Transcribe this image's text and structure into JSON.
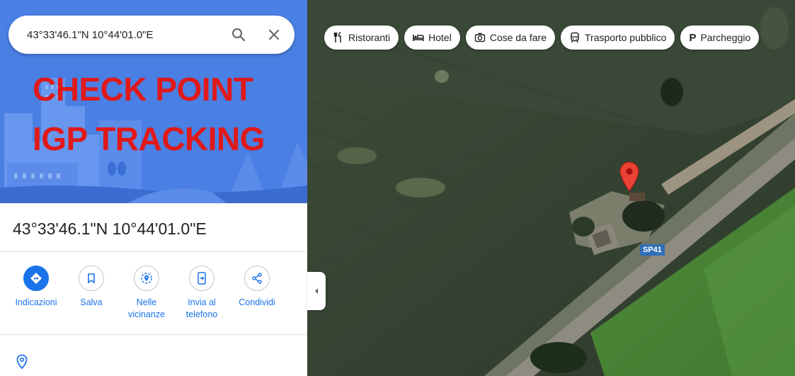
{
  "search": {
    "value": "43°33'46.1\"N 10°44'01.0\"E",
    "search_icon": "search-icon",
    "close_icon": "close-icon"
  },
  "hero": {
    "overlay_line1": "CHECK POINT",
    "overlay_line2": "IGP TRACKING",
    "overlay_color": "#e01919"
  },
  "place": {
    "title": "43°33'46.1\"N 10°44'01.0\"E"
  },
  "actions": [
    {
      "label": "Indicazioni",
      "icon": "directions-icon"
    },
    {
      "label": "Salva",
      "icon": "bookmark-icon"
    },
    {
      "label": "Nelle vicinanze",
      "icon": "nearby-icon"
    },
    {
      "label": "Invia al telefono",
      "icon": "send-to-phone-icon"
    },
    {
      "label": "Condividi",
      "icon": "share-icon"
    }
  ],
  "map": {
    "chips": [
      {
        "label": "Ristoranti",
        "icon": "restaurant-icon"
      },
      {
        "label": "Hotel",
        "icon": "hotel-icon"
      },
      {
        "label": "Cose da fare",
        "icon": "camera-icon"
      },
      {
        "label": "Trasporto pubblico",
        "icon": "transit-icon"
      },
      {
        "label": "Parcheggio",
        "icon": "parking-icon",
        "icon_text": "P"
      }
    ],
    "road_label": "SP41",
    "pin_color": "#ea4335"
  },
  "colors": {
    "accent": "#1a73e8",
    "hero_bg": "#4a7fe3"
  }
}
